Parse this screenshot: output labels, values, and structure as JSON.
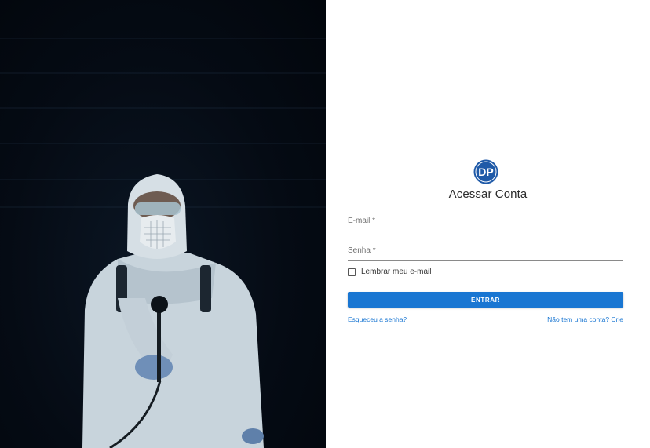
{
  "hero": {
    "image_icon": "hazmat-sprayer-image"
  },
  "login": {
    "logo_icon": "dp-logo-icon",
    "title": "Acessar Conta",
    "email": {
      "label": "E-mail *",
      "value": ""
    },
    "password": {
      "label": "Senha *",
      "value": ""
    },
    "remember_label": "Lembrar meu e-mail",
    "remember_checked": false,
    "submit_label": "ENTRAR",
    "forgot_link": "Esqueceu a senha?",
    "signup_link": "Não tem uma conta? Crie"
  },
  "colors": {
    "primary": "#1976d2",
    "hero_bg": "#050b14",
    "logo_blue": "#1f5aa8"
  }
}
